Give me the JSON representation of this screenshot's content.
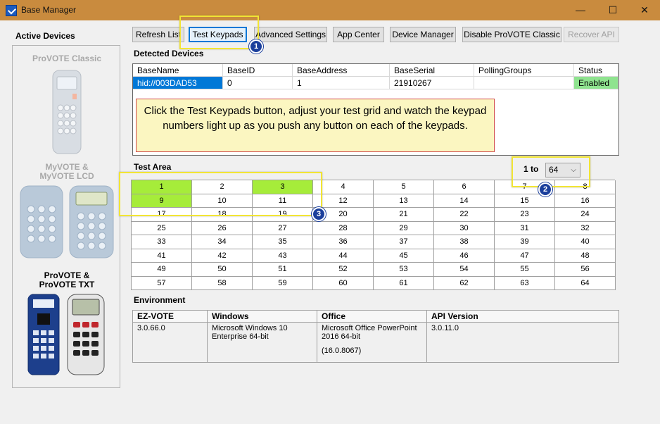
{
  "window": {
    "title": "Base Manager"
  },
  "left": {
    "heading": "Active Devices",
    "devices": [
      {
        "label1": "ProVOTE Classic",
        "label2": ""
      },
      {
        "label1": "MyVOTE &",
        "label2": "MyVOTE LCD"
      },
      {
        "label1": "ProVOTE &",
        "label2": "ProVOTE TXT"
      }
    ]
  },
  "toolbar": {
    "refresh": "Refresh List",
    "test": "Test Keypads",
    "advanced": "Advanced Settings",
    "app_center": "App Center",
    "device_manager": "Device Manager",
    "disable": "Disable ProVOTE Classic",
    "recover": "Recover API"
  },
  "detected": {
    "heading": "Detected Devices",
    "columns": [
      "BaseName",
      "BaseID",
      "BaseAddress",
      "BaseSerial",
      "PollingGroups",
      "Status"
    ],
    "row": [
      "hid://003DAD53",
      "0",
      "1",
      "21910267",
      "",
      "Enabled"
    ]
  },
  "callout": "Click the Test Keypads button, adjust your test grid and watch the keypad numbers light up as you push any button on each of the keypads.",
  "test_area": {
    "heading": "Test Area",
    "range_label": "1 to",
    "range_value": "64",
    "cells": [
      "1",
      "2",
      "3",
      "4",
      "5",
      "6",
      "7",
      "8",
      "9",
      "10",
      "11",
      "12",
      "13",
      "14",
      "15",
      "16",
      "17",
      "18",
      "19",
      "20",
      "21",
      "22",
      "23",
      "24",
      "25",
      "26",
      "27",
      "28",
      "29",
      "30",
      "31",
      "32",
      "33",
      "34",
      "35",
      "36",
      "37",
      "38",
      "39",
      "40",
      "41",
      "42",
      "43",
      "44",
      "45",
      "46",
      "47",
      "48",
      "49",
      "50",
      "51",
      "52",
      "53",
      "54",
      "55",
      "56",
      "57",
      "58",
      "59",
      "60",
      "61",
      "62",
      "63",
      "64"
    ],
    "lit": [
      "1",
      "3",
      "9"
    ]
  },
  "environment": {
    "heading": "Environment",
    "columns": [
      {
        "header": "EZ-VOTE",
        "lines": [
          "3.0.66.0"
        ]
      },
      {
        "header": "Windows",
        "lines": [
          "Microsoft Windows 10",
          "Enterprise 64-bit"
        ]
      },
      {
        "header": "Office",
        "lines": [
          "Microsoft Office PowerPoint",
          "2016  64-bit",
          "",
          "(16.0.8067)"
        ]
      },
      {
        "header": "API Version",
        "lines": [
          "3.0.11.0"
        ]
      }
    ]
  },
  "badges": [
    "1",
    "2",
    "3"
  ],
  "colors": {
    "titlebar": "#c98b3e",
    "lit": "#a6ec3a",
    "enabled": "#8fe38f",
    "selected": "#0078d7",
    "highlight": "#f2e534",
    "badge": "#1b3f9c"
  }
}
